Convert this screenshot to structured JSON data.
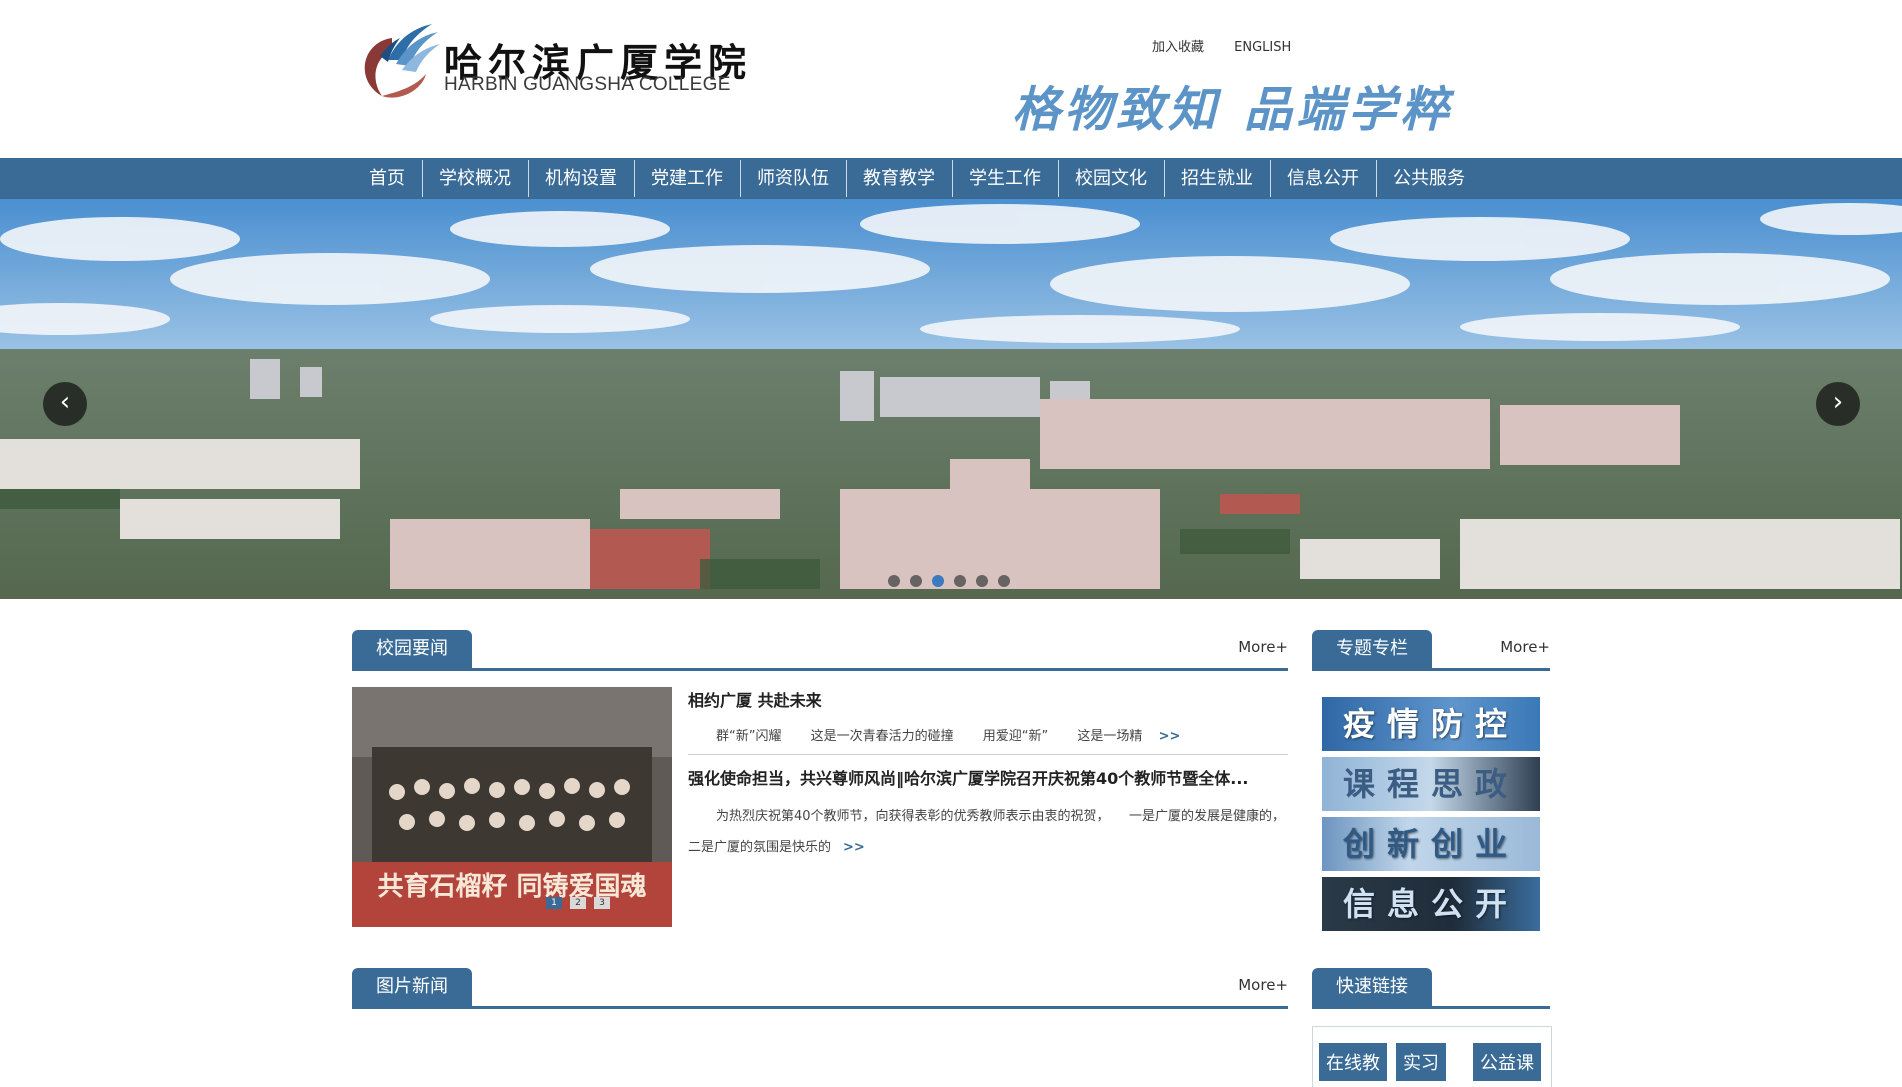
{
  "header": {
    "logo_cn": "哈尔滨广厦学院",
    "logo_en": "HARBIN GUANGSHA COLLEGE",
    "links": {
      "favorite": "加入收藏",
      "english": "ENGLISH"
    },
    "motto_part1": "格物致知",
    "motto_part2": "品端学粹"
  },
  "nav": {
    "items": [
      "首页",
      "学校概况",
      "机构设置",
      "党建工作",
      "师资队伍",
      "教育教学",
      "学生工作",
      "校园文化",
      "招生就业",
      "信息公开",
      "公共服务"
    ]
  },
  "banner": {
    "prev_icon": "chevron-left-icon",
    "next_icon": "chevron-right-icon",
    "prev_glyph": "‹",
    "next_glyph": "›",
    "slide_count": 6,
    "active_slide": 3
  },
  "news": {
    "tab": "校园要闻",
    "more": "More+",
    "photo_caption": "共育石榴籽 同铸爱国魂",
    "photo_pages": [
      "1",
      "2",
      "3"
    ],
    "items": [
      {
        "title": "相约广厦 共赴未来",
        "summary_parts": [
          "群“新”闪耀",
          "这是一次青春活力的碰撞",
          "用爱迎“新”",
          "这是一场精"
        ],
        "more": ">>"
      },
      {
        "title": "强化使命担当，共兴尊师风尚‖哈尔滨广厦学院召开庆祝第40个教师节暨全体...",
        "summary": "为热烈庆祝第40个教师节，向获得表彰的优秀教师表示由衷的祝贺，　　一是广厦的发展是健康的，　　二是广厦的氛围是快乐的",
        "more": ">>"
      }
    ]
  },
  "topics": {
    "tab": "专题专栏",
    "more": "More+",
    "items": [
      "疫情防控",
      "课程思政",
      "创新创业",
      "信息公开"
    ]
  },
  "photo_news": {
    "tab": "图片新闻",
    "more": "More+"
  },
  "quick_links": {
    "tab": "快速链接",
    "items": [
      "在线教",
      "实习",
      "公益课"
    ]
  },
  "colors": {
    "primary": "#3a6b96",
    "motto": "#5c94c7",
    "accent_dot": "#3a7bbf"
  }
}
